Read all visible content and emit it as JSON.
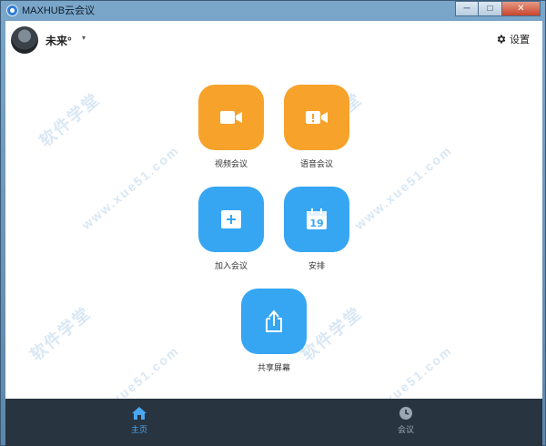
{
  "window": {
    "title": "MAXHUB云会议",
    "controls": {
      "minimize": "─",
      "maximize": "□",
      "close": "✕"
    }
  },
  "header": {
    "user_name": "未来°",
    "user_caret": "▾",
    "settings_label": "设置"
  },
  "tiles": [
    {
      "label": "视频会议",
      "icon": "video-camera-icon",
      "color": "#f7a22a"
    },
    {
      "label": "语音会议",
      "icon": "voice-camera-icon",
      "color": "#f7a22a"
    },
    {
      "label": "加入会议",
      "icon": "plus-box-icon",
      "color": "#36a6f3"
    },
    {
      "label": "安排",
      "icon": "calendar-icon",
      "color": "#36a6f3",
      "calendar_day": "19"
    },
    {
      "label": "共享屏幕",
      "icon": "share-upload-icon",
      "color": "#36a6f3"
    }
  ],
  "bottom_nav": {
    "items": [
      {
        "label": "主页",
        "icon": "home-icon",
        "active": true
      },
      {
        "label": "会议",
        "icon": "clock-icon",
        "active": false
      }
    ]
  },
  "watermark": {
    "brand": "软件学堂",
    "site": "www.xue51.com"
  }
}
